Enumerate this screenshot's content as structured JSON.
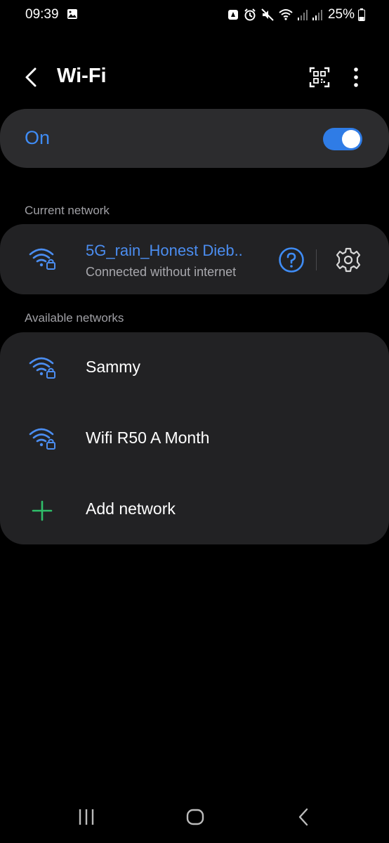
{
  "status_bar": {
    "time": "09:39",
    "battery": "25%",
    "icons": [
      "gallery-icon",
      "notification-icon",
      "alarm-icon",
      "mute-icon",
      "wifi-icon",
      "signal-icon",
      "signal-icon",
      "battery-icon"
    ]
  },
  "header": {
    "title": "Wi-Fi",
    "back_icon": "chevron-left-icon",
    "qr_icon": "qr-code-icon",
    "more_icon": "more-vertical-icon"
  },
  "wifi_toggle": {
    "label": "On",
    "enabled": true
  },
  "current_network": {
    "section_label": "Current network",
    "name": "5G_rain_Honest Dieb..",
    "status": "Connected without internet",
    "icon": "wifi-lock-icon"
  },
  "available_networks": {
    "section_label": "Available networks",
    "items": [
      {
        "name": "Sammy",
        "icon": "wifi-lock-icon"
      },
      {
        "name": "Wifi R50 A Month",
        "icon": "wifi-lock-icon"
      }
    ],
    "add_label": "Add network"
  },
  "colors": {
    "accent": "#3f8cf5",
    "card": "#222224",
    "toggle_card": "#2c2c2e",
    "add_icon": "#2fbf6a",
    "background": "#000000"
  }
}
